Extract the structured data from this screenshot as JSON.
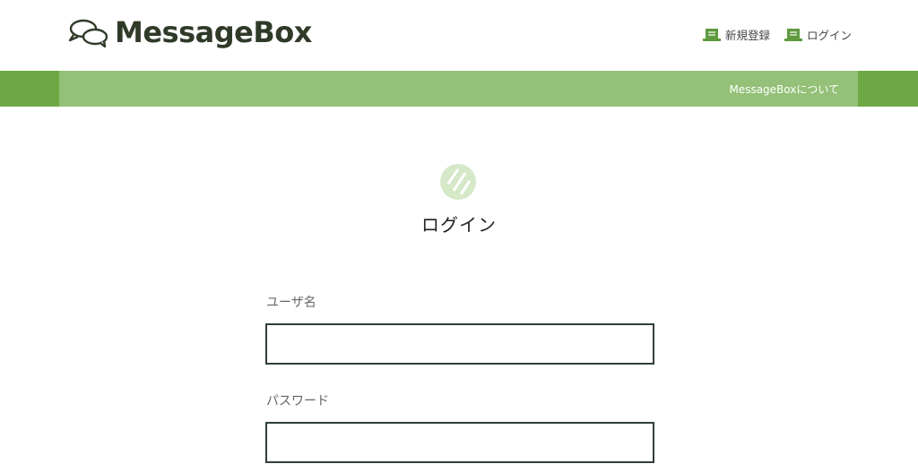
{
  "header": {
    "logo_text": "MessageBox",
    "nav": [
      {
        "label": "新規登録"
      },
      {
        "label": "ログイン"
      }
    ]
  },
  "band": {
    "about_label": "MessageBoxについて"
  },
  "login": {
    "title": "ログイン",
    "fields": [
      {
        "label": "ユーザ名",
        "value": "",
        "placeholder": ""
      },
      {
        "label": "パスワード",
        "value": "",
        "placeholder": ""
      }
    ]
  },
  "colors": {
    "brand_dark": "#2f3a28",
    "green_dark": "#6da845",
    "green_light": "#94c078",
    "icon_green": "#d5e8c8",
    "input_border": "#2f3f38"
  }
}
